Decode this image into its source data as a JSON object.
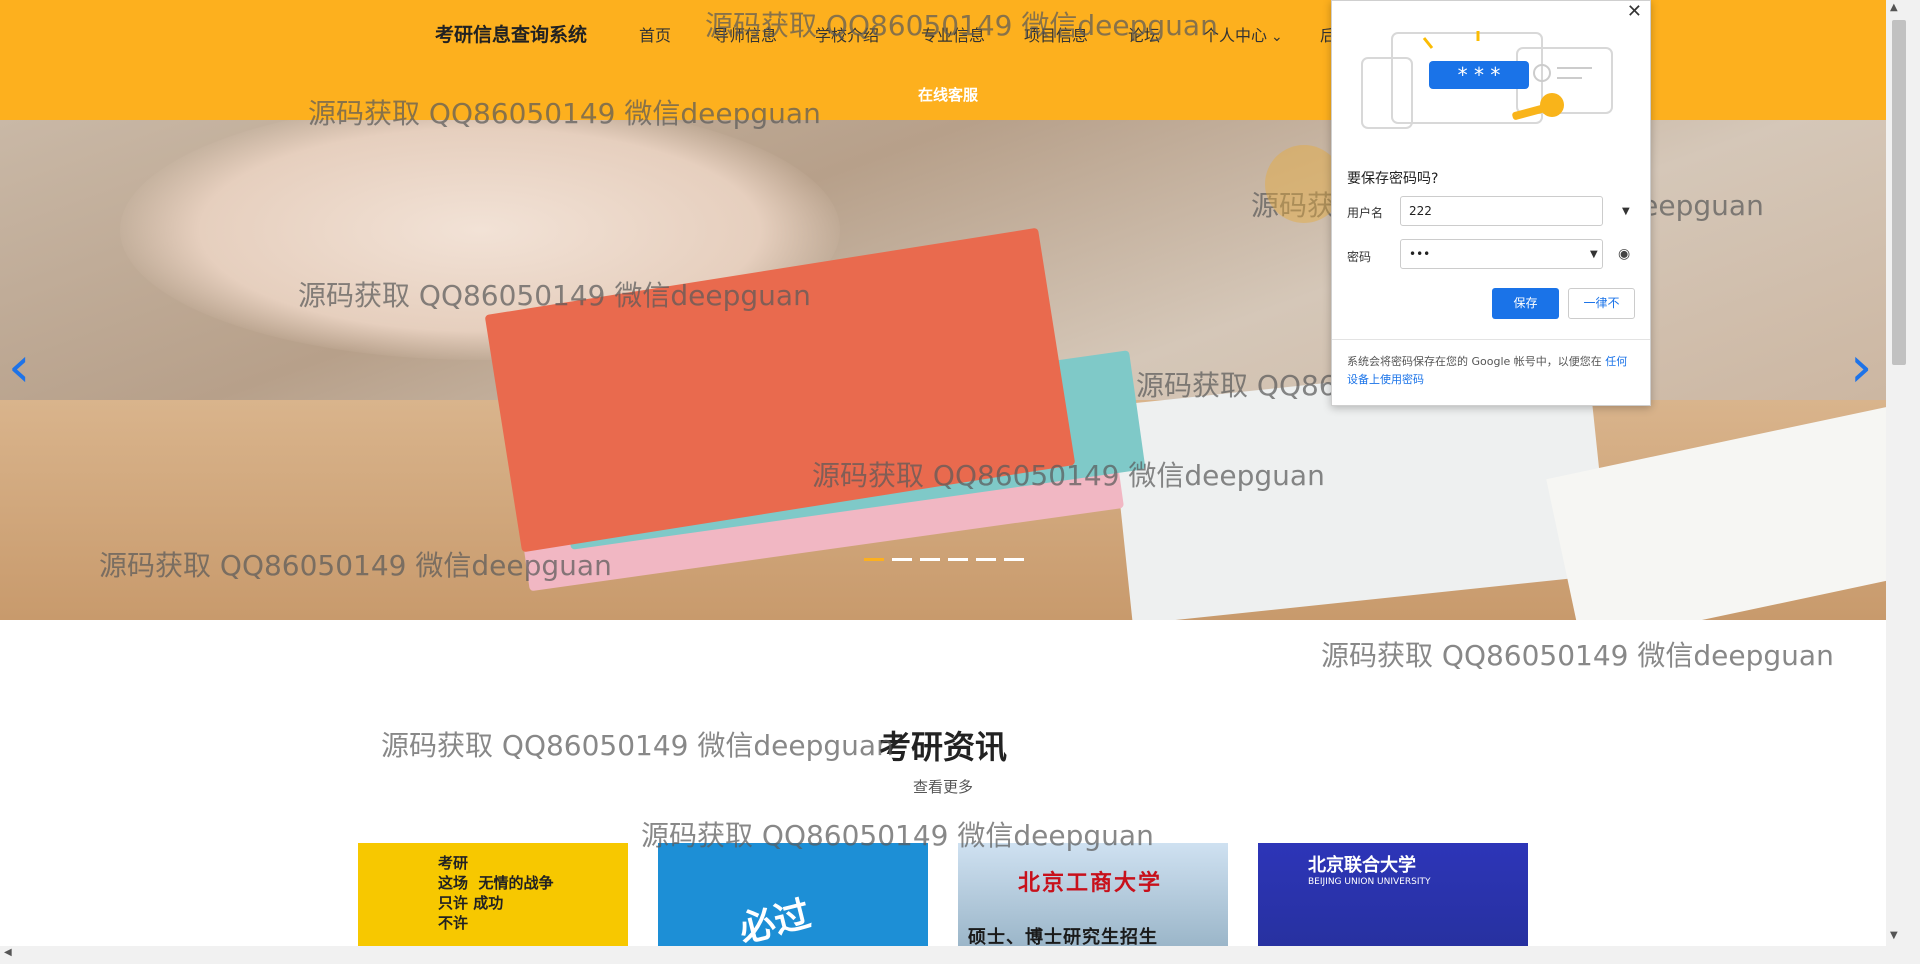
{
  "header": {
    "brand": "考研信息查询系统",
    "nav": [
      {
        "label": "首页"
      },
      {
        "label": "导师信息"
      },
      {
        "label": "学校介绍"
      },
      {
        "label": "专业信息"
      },
      {
        "label": "项目信息"
      },
      {
        "label": "论坛"
      },
      {
        "label": "个人中心"
      },
      {
        "label": "后"
      }
    ],
    "service": "在线客服",
    "bg_color": "#fdb01e"
  },
  "carousel": {
    "prev_icon": "‹",
    "next_icon": "›",
    "slide_count": 6,
    "active_index": 0
  },
  "news": {
    "title": "考研资讯",
    "more": "查看更多",
    "cards": [
      {
        "text": "考研\n这场  无情的战争\n只许 成功\n不许"
      },
      {
        "text": "必过"
      },
      {
        "title": "北京工商大学",
        "subtitle": "硕士、博士研究生招生"
      },
      {
        "title": "北京联合大学",
        "subtitle": "BEIJING UNION UNIVERSITY"
      }
    ]
  },
  "password_dialog": {
    "title": "要保存密码吗?",
    "username_label": "用户名",
    "username_value": "222",
    "password_label": "密码",
    "password_value": "•••",
    "save": "保存",
    "never": "一律不",
    "footer": "系统会将密码保存在您的 Google 帐号中，以便您在",
    "footer_link": "任何设备上使用密码",
    "close": "✕",
    "masked": "* * *"
  },
  "watermark": "源码获取 QQ86050149 微信deepguan",
  "colors": {
    "accent": "#1a73e8",
    "brand": "#fdb01e"
  }
}
